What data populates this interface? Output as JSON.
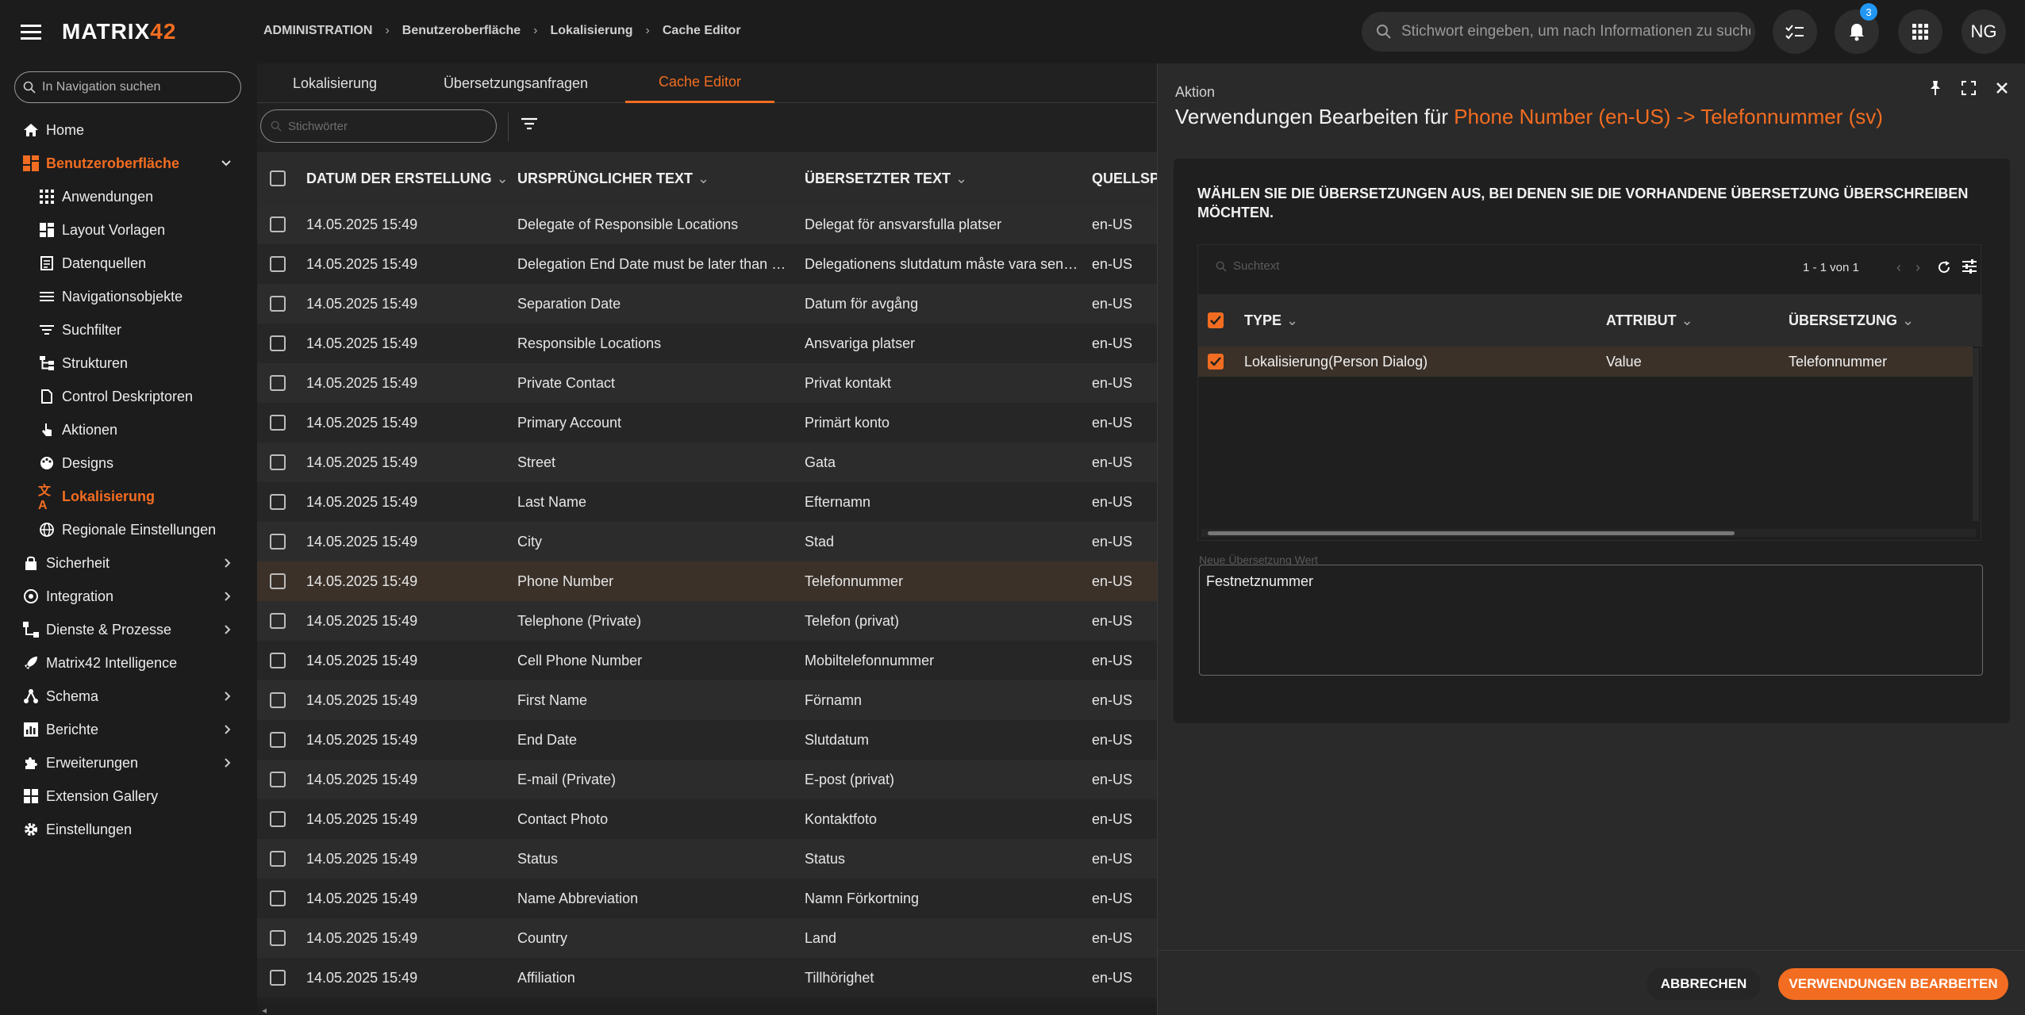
{
  "app": {
    "logo_main": "MATRIX",
    "logo_accent": "42"
  },
  "breadcrumb": [
    "ADMINISTRATION",
    "Benutzeroberfläche",
    "Lokalisierung",
    "Cache Editor"
  ],
  "global_search": {
    "placeholder": "Stichwort eingeben, um nach Informationen zu suchen"
  },
  "top_actions": {
    "notifications_count": "3",
    "avatar_initials": "NG"
  },
  "nav": {
    "search_placeholder": "In Navigation suchen",
    "items": [
      {
        "label": "Home",
        "icon": "home-icon"
      },
      {
        "label": "Benutzeroberfläche",
        "icon": "dashboard-icon"
      },
      {
        "label": "Anwendungen",
        "icon": "apps-icon"
      },
      {
        "label": "Layout Vorlagen",
        "icon": "layout-icon"
      },
      {
        "label": "Datenquellen",
        "icon": "datasource-icon"
      },
      {
        "label": "Navigationsobjekte",
        "icon": "list-icon"
      },
      {
        "label": "Suchfilter",
        "icon": "filter-icon"
      },
      {
        "label": "Strukturen",
        "icon": "structure-icon"
      },
      {
        "label": "Control Deskriptoren",
        "icon": "control-icon"
      },
      {
        "label": "Aktionen",
        "icon": "touch-icon"
      },
      {
        "label": "Designs",
        "icon": "palette-icon"
      },
      {
        "label": "Lokalisierung",
        "icon": "translate-icon"
      },
      {
        "label": "Regionale Einstellungen",
        "icon": "globe-icon"
      },
      {
        "label": "Sicherheit",
        "icon": "lock-icon"
      },
      {
        "label": "Integration",
        "icon": "integration-icon"
      },
      {
        "label": "Dienste & Prozesse",
        "icon": "process-icon"
      },
      {
        "label": "Matrix42 Intelligence",
        "icon": "rocket-icon"
      },
      {
        "label": "Schema",
        "icon": "schema-icon"
      },
      {
        "label": "Berichte",
        "icon": "report-icon"
      },
      {
        "label": "Erweiterungen",
        "icon": "puzzle-icon"
      },
      {
        "label": "Extension Gallery",
        "icon": "gallery-icon"
      },
      {
        "label": "Einstellungen",
        "icon": "gear-icon"
      }
    ]
  },
  "tabs": [
    "Lokalisierung",
    "Übersetzungsanfragen",
    "Cache Editor"
  ],
  "toolbar": {
    "keyword_placeholder": "Stichwörter"
  },
  "grid": {
    "columns": [
      "DATUM DER ERSTELLUNG",
      "URSPRÜNGLICHER TEXT",
      "ÜBERSETZTER TEXT",
      "QUELLSPR"
    ],
    "rows": [
      [
        "14.05.2025 15:49",
        "Delegate of Responsible Locations",
        "Delegat för ansvarsfulla platser",
        "en-US"
      ],
      [
        "14.05.2025 15:49",
        "Delegation End Date must be later than Delegation Start Date",
        "Delegationens slutdatum måste vara senare än startdatum",
        "en-US"
      ],
      [
        "14.05.2025 15:49",
        "Separation Date",
        "Datum för avgång",
        "en-US"
      ],
      [
        "14.05.2025 15:49",
        "Responsible Locations",
        "Ansvariga platser",
        "en-US"
      ],
      [
        "14.05.2025 15:49",
        "Private Contact",
        "Privat kontakt",
        "en-US"
      ],
      [
        "14.05.2025 15:49",
        "Primary Account",
        "Primärt konto",
        "en-US"
      ],
      [
        "14.05.2025 15:49",
        "Street",
        "Gata",
        "en-US"
      ],
      [
        "14.05.2025 15:49",
        "Last Name",
        "Efternamn",
        "en-US"
      ],
      [
        "14.05.2025 15:49",
        "City",
        "Stad",
        "en-US"
      ],
      [
        "14.05.2025 15:49",
        "Phone Number",
        "Telefonnummer",
        "en-US"
      ],
      [
        "14.05.2025 15:49",
        "Telephone (Private)",
        "Telefon (privat)",
        "en-US"
      ],
      [
        "14.05.2025 15:49",
        "Cell Phone Number",
        "Mobiltelefonnummer",
        "en-US"
      ],
      [
        "14.05.2025 15:49",
        "First Name",
        "Förnamn",
        "en-US"
      ],
      [
        "14.05.2025 15:49",
        "End Date",
        "Slutdatum",
        "en-US"
      ],
      [
        "14.05.2025 15:49",
        "E-mail (Private)",
        "E-post (privat)",
        "en-US"
      ],
      [
        "14.05.2025 15:49",
        "Contact Photo",
        "Kontaktfoto",
        "en-US"
      ],
      [
        "14.05.2025 15:49",
        "Status",
        "Status",
        "en-US"
      ],
      [
        "14.05.2025 15:49",
        "Name Abbreviation",
        "Namn Förkortning",
        "en-US"
      ],
      [
        "14.05.2025 15:49",
        "Country",
        "Land",
        "en-US"
      ],
      [
        "14.05.2025 15:49",
        "Affiliation",
        "Tillhörighet",
        "en-US"
      ]
    ]
  },
  "panel": {
    "kicker": "Aktion",
    "title_prefix": "Verwendungen Bearbeiten für ",
    "title_highlight": "Phone Number (en-US) -> Telefonnummer (sv)",
    "heading": "WÄHLEN SIE DIE ÜBERSETZUNGEN AUS, BEI DENEN SIE DIE VORHANDENE ÜBERSETZUNG ÜBERSCHREIBEN MÖCHTEN.",
    "search_placeholder": "Suchtext",
    "pager": "1 - 1 von 1",
    "columns": [
      "TYPE",
      "ATTRIBUT",
      "ÜBERSETZUNG"
    ],
    "row": {
      "type": "Lokalisierung(Person Dialog)",
      "attribut": "Value",
      "uebersetzung": "Telefonnummer"
    },
    "new_value_label": "Neue Übersetzung Wert",
    "new_value": "Festnetznummer",
    "cancel_label": "ABBRECHEN",
    "confirm_label": "VERWENDUNGEN BEARBEITEN"
  },
  "colors": {
    "accent": "#f26d21",
    "badge": "#2196f3"
  }
}
